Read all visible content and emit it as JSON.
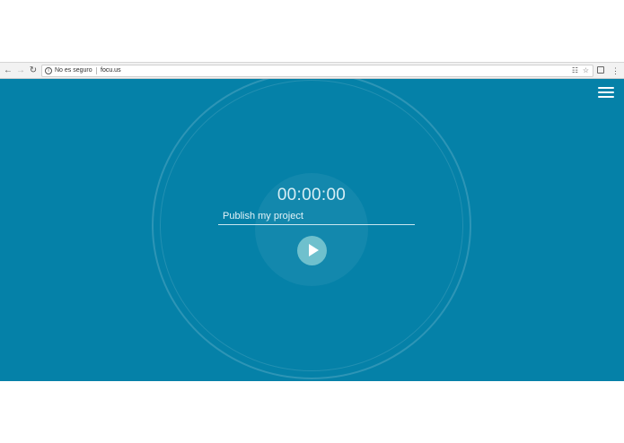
{
  "browser": {
    "security_text": "No es seguro",
    "url": "focu.us",
    "icons": {
      "back": "arrow-left-icon",
      "forward": "arrow-right-icon",
      "reload": "reload-icon",
      "info": "info-icon",
      "translate": "translate-icon",
      "bookmark": "star-icon",
      "extension": "extension-icon",
      "menu": "more-vert-icon"
    }
  },
  "app": {
    "timer": "00:00:00",
    "task_value": "Publish my project",
    "colors": {
      "background": "#0581a8",
      "play_button": "#6fc0cd",
      "text": "#d6eef5"
    },
    "icons": {
      "menu": "hamburger-menu-icon",
      "play": "play-icon"
    }
  }
}
